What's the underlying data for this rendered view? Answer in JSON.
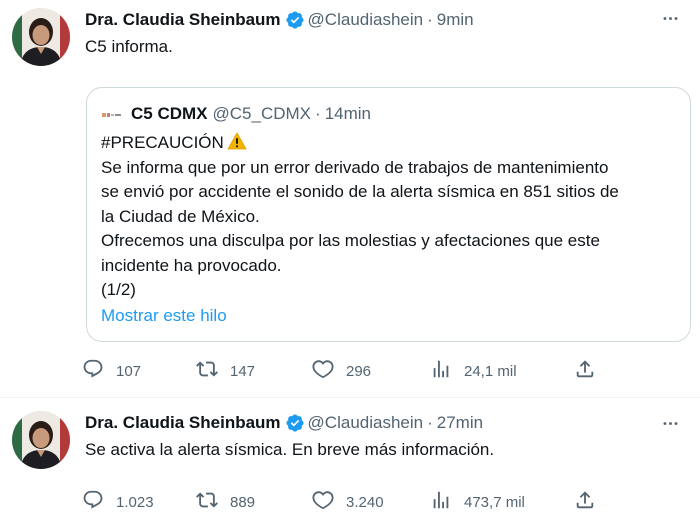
{
  "tweets": [
    {
      "author_name": "Dra. Claudia Sheinbaum",
      "handle": "@Claudiashein",
      "separator": "·",
      "time": "9min",
      "text": "C5 informa.",
      "quote": {
        "author_name": "C5 CDMX",
        "handle": "@C5_CDMX",
        "separator": "·",
        "time": "14min",
        "lines": [
          "#PRECAUCIÓN",
          "Se informa que por un error derivado de trabajos de mantenimiento",
          "se envió por accidente el sonido de la alerta sísmica en 851 sitios de",
          "la Ciudad de México.",
          "Ofrecemos una disculpa por las molestias y afectaciones que este",
          "incidente ha provocado.",
          "(1/2)"
        ],
        "show_thread": "Mostrar este hilo"
      },
      "actions": {
        "replies": "107",
        "retweets": "147",
        "likes": "296",
        "views": "24,1 mil"
      }
    },
    {
      "author_name": "Dra. Claudia Sheinbaum",
      "handle": "@Claudiashein",
      "separator": "·",
      "time": "27min",
      "text": "Se activa la alerta sísmica. En breve más información.",
      "actions": {
        "replies": "1.023",
        "retweets": "889",
        "likes": "3.240",
        "views": "473,7 mil"
      }
    }
  ],
  "icons": {
    "verified": "verified-badge-icon",
    "more": "more-options-icon",
    "reply": "reply-icon",
    "retweet": "retweet-icon",
    "like": "heart-icon",
    "views": "views-chart-icon",
    "share": "share-icon",
    "warning": "warning-emoji-icon"
  },
  "colors": {
    "verified": "#1d9bf0",
    "link": "#1d9bf0",
    "secondary": "#536471",
    "text": "#0f1419",
    "border": "#cfd9de"
  }
}
